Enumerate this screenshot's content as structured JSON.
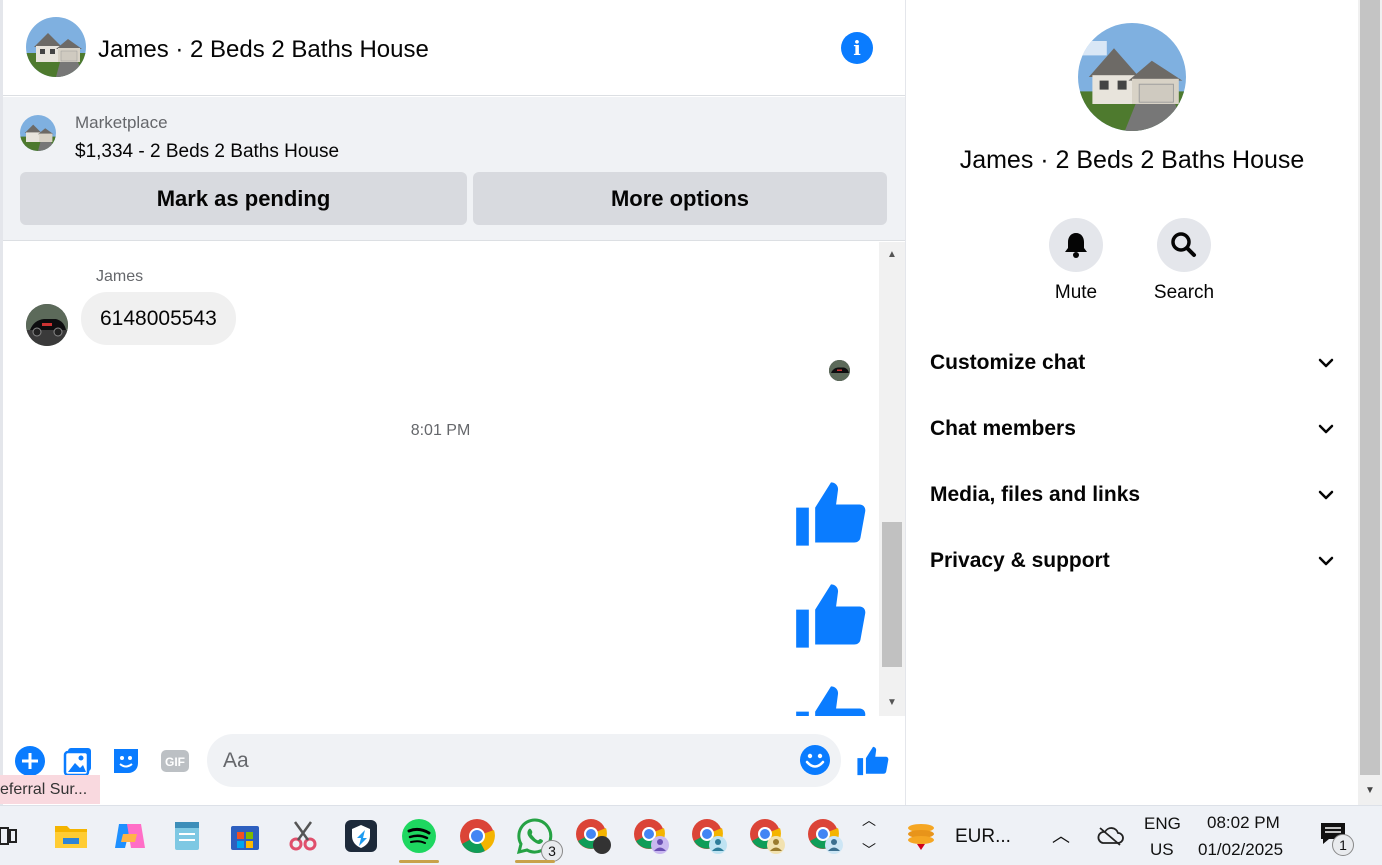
{
  "header": {
    "title": "James · 2 Beds 2 Baths House"
  },
  "marketplace": {
    "label": "Marketplace",
    "item": "$1,334 - 2 Beds 2 Baths House",
    "mark_pending": "Mark as pending",
    "more_options": "More options"
  },
  "messages": {
    "sender": "James",
    "text": "6148005543",
    "timestamp": "8:01 PM"
  },
  "composer": {
    "placeholder": "Aa"
  },
  "tooltip": "eferral Sur...",
  "details": {
    "title": "James · 2 Beds 2 Baths House",
    "mute": "Mute",
    "search": "Search",
    "sections": [
      "Customize chat",
      "Chat members",
      "Media, files and links",
      "Privacy & support"
    ]
  },
  "taskbar": {
    "whatsapp_badge": "3",
    "currency": "EUR...",
    "lang": "ENG",
    "region": "US",
    "time": "08:02 PM",
    "date": "01/02/2025",
    "notif_count": "1"
  },
  "colors": {
    "accent": "#0a7cff",
    "bubble": "#f0f0f0",
    "panel": "#f0f2f5"
  }
}
